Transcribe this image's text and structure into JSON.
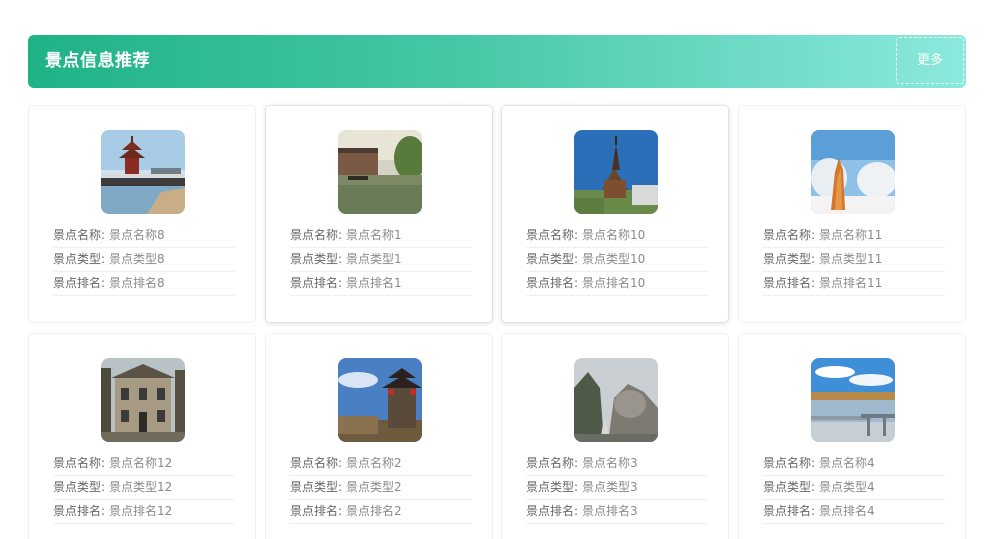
{
  "header": {
    "title": "景点信息推荐",
    "more_label": "更多"
  },
  "labels": {
    "name": "景点名称:",
    "type": "景点类型:",
    "rank": "景点排名:"
  },
  "spots": [
    {
      "name": "景点名称8",
      "type": "景点类型8",
      "rank": "景点排名8",
      "image": "pagoda-pier-photo"
    },
    {
      "name": "景点名称1",
      "type": "景点类型1",
      "rank": "景点排名1",
      "image": "water-town-canal-photo"
    },
    {
      "name": "景点名称10",
      "type": "景点类型10",
      "rank": "景点排名10",
      "image": "wooden-church-photo"
    },
    {
      "name": "景点名称11",
      "type": "景点类型11",
      "rank": "景点排名11",
      "image": "frost-monument-photo"
    },
    {
      "name": "景点名称12",
      "type": "景点类型12",
      "rank": "景点排名12",
      "image": "old-villa-photo"
    },
    {
      "name": "景点名称2",
      "type": "景点类型2",
      "rank": "景点排名2",
      "image": "chinese-gate-photo"
    },
    {
      "name": "景点名称3",
      "type": "景点类型3",
      "rank": "景点排名3",
      "image": "rocky-mountain-photo"
    },
    {
      "name": "景点名称4",
      "type": "景点类型4",
      "rank": "景点排名4",
      "image": "lake-boardwalk-photo"
    }
  ]
}
